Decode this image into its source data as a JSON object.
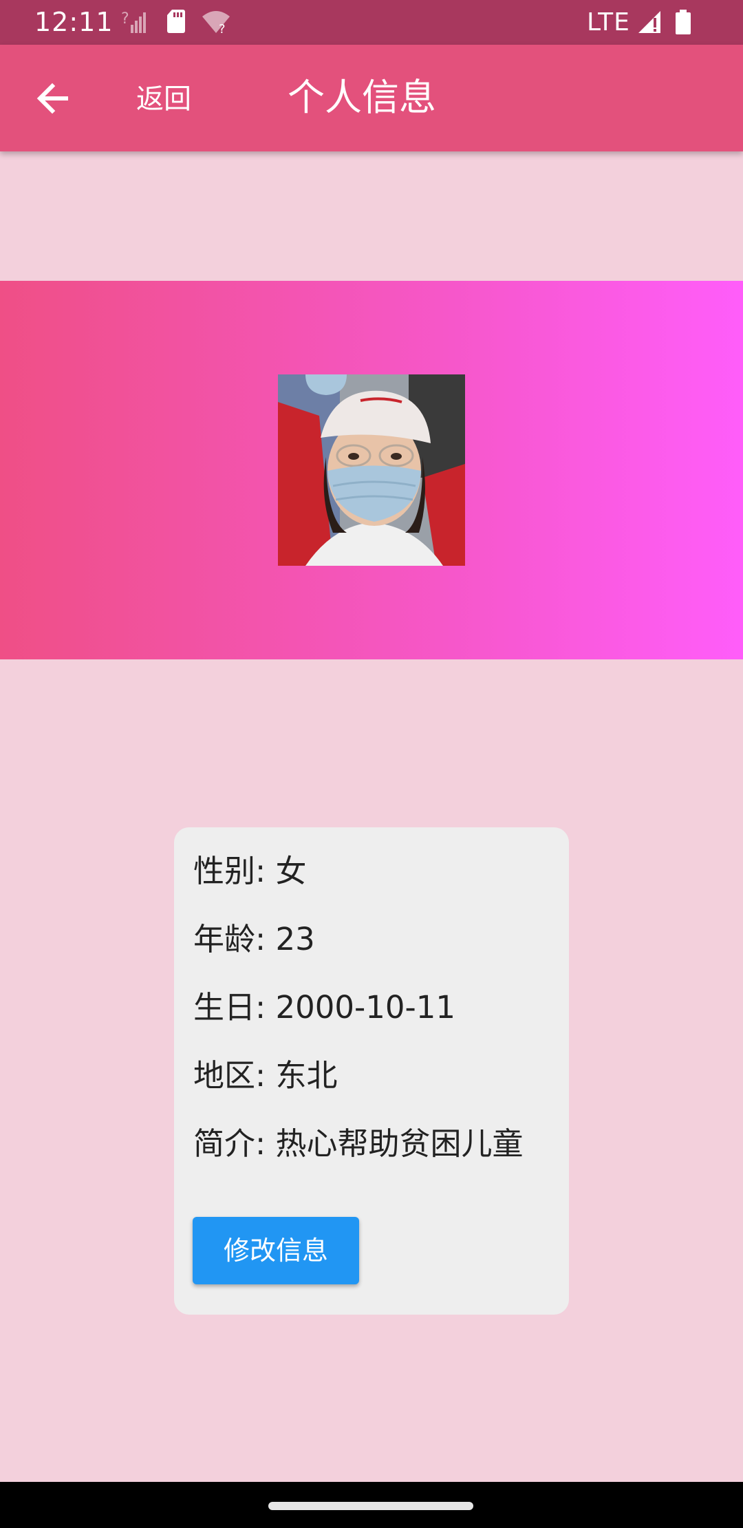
{
  "status_bar": {
    "time": "12:11",
    "network": "LTE",
    "icons": [
      "signal-question-icon",
      "sd-card-icon",
      "wifi-question-icon",
      "cell-signal-icon",
      "battery-icon"
    ]
  },
  "app_bar": {
    "back_icon": "arrow-left-icon",
    "back_label": "返回",
    "title": "个人信息"
  },
  "profile": {
    "avatar": "profile-photo",
    "gender_line": "性别: 女",
    "age_line": "年龄: 23",
    "birthday_line": "生日: 2000-10-11",
    "region_line": "地区: 东北",
    "intro_line": "简介: 热心帮助贫困儿童",
    "edit_button_label": "修改信息"
  },
  "colors": {
    "status_bar": "#a8385e",
    "app_bar": "#e3517c",
    "page_background": "#f3d0dc",
    "banner_start": "#ef4f86",
    "banner_end": "#ff5dfa",
    "card": "#eeeeee",
    "button": "#2196f3"
  }
}
